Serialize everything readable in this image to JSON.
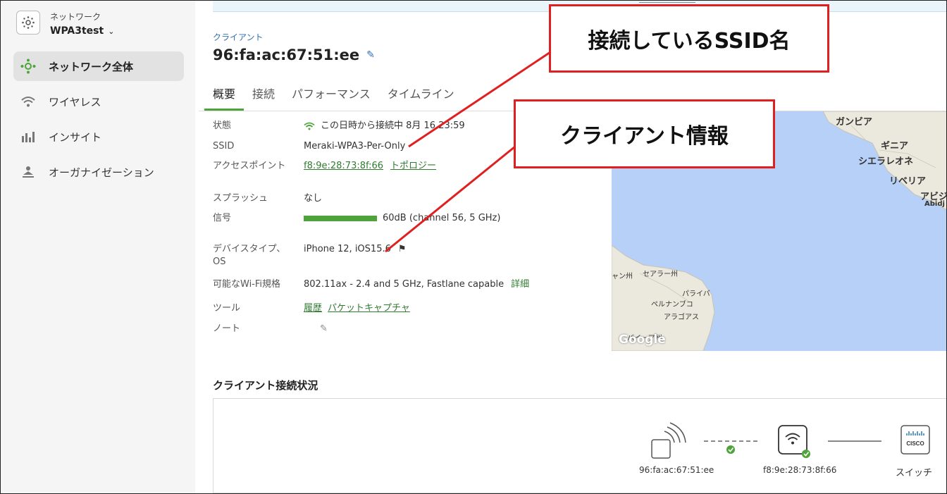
{
  "sidebar": {
    "network_label": "ネットワーク",
    "network_name": "WPA3test",
    "items": [
      {
        "label": "ネットワーク全体",
        "icon": "network-wide-icon",
        "active": true
      },
      {
        "label": "ワイヤレス",
        "icon": "wifi-icon"
      },
      {
        "label": "インサイト",
        "icon": "insight-chart-icon"
      },
      {
        "label": "オーガナイゼーション",
        "icon": "organization-icon"
      }
    ]
  },
  "header": {
    "breadcrumb": "クライアント",
    "title": "96:fa:ac:67:51:ee"
  },
  "tabs": [
    "概要",
    "接続",
    "パフォーマンス",
    "タイムライン"
  ],
  "details": {
    "status": {
      "label": "状態",
      "value": "この日時から接続中 8月 16 23:59"
    },
    "ssid": {
      "label": "SSID",
      "value": "Meraki-WPA3-Per-Only"
    },
    "ap": {
      "label": "アクセスポイント",
      "value": "f8:9e:28:73:8f:66",
      "link": "トポロジー"
    },
    "splash": {
      "label": "スプラッシュ",
      "value": "なし"
    },
    "signal": {
      "label": "信号",
      "value": "60dB (channel 56, 5 GHz)"
    },
    "device": {
      "label": "デバイスタイプ、OS",
      "value": "iPhone 12, iOS15.6"
    },
    "wifi": {
      "label": "可能なWi-Fi規格",
      "value": "802.11ax - 2.4 and 5 GHz, Fastlane capable",
      "link": "詳細"
    },
    "tools": {
      "label": "ツール",
      "link1": "履歴",
      "link2": "パケットキャプチャ"
    },
    "note": {
      "label": "ノート"
    }
  },
  "map": {
    "zoom_out": "−",
    "labels": [
      "ガンビア",
      "ギニア",
      "シエラレオネ",
      "リベリア",
      "アビジャ",
      "Abidj",
      "ャン州",
      "セアラー州",
      "パライバ",
      "ペルナンブコ",
      "アラゴアス",
      "バイーア州"
    ],
    "attribution": "Google"
  },
  "connection": {
    "title": "クライアント接続状況",
    "client": "96:fa:ac:67:51:ee",
    "ap": "f8:9e:28:73:8f:66",
    "switch": "スイッチ",
    "switch_brand": "CISCO"
  },
  "annotations": {
    "ssid_callout": "接続しているSSID名",
    "client_callout": "クライアント情報"
  },
  "colors": {
    "accent_green": "#4ea43a",
    "annotation_red": "#e02020",
    "link_blue": "#2f6fb5"
  }
}
